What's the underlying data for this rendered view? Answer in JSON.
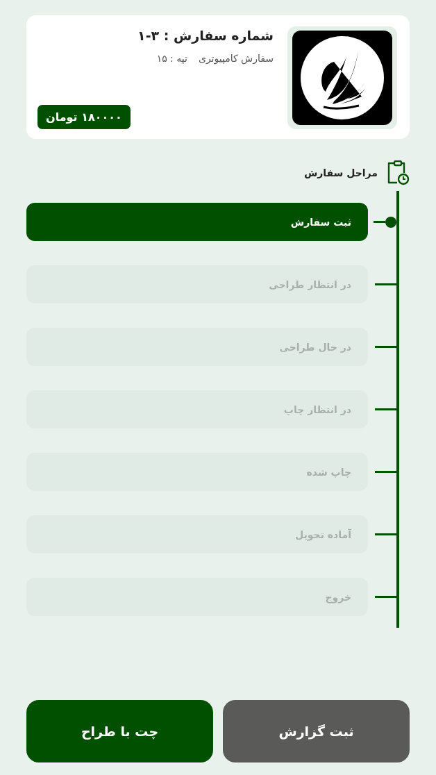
{
  "order": {
    "title": "شماره سفارش : ۳-۱",
    "category": "سفارش کامپیوتری",
    "hill": "تپه : ۱۵",
    "price": "۱۸۰۰۰۰ تومان"
  },
  "stages": {
    "title": "مراحل سفارش",
    "steps": [
      {
        "label": "ثبت سفارش",
        "selected": true
      },
      {
        "label": "در انتظار طراحی",
        "selected": false
      },
      {
        "label": "در حال طراحی",
        "selected": false
      },
      {
        "label": "در انتظار چاپ",
        "selected": false
      },
      {
        "label": "چاپ شده",
        "selected": false
      },
      {
        "label": "آماده تحویل",
        "selected": false
      },
      {
        "label": "خروج",
        "selected": false
      }
    ]
  },
  "buttons": [
    {
      "label": "ثبت گزارش",
      "kind": "secondary"
    },
    {
      "label": "چت با طراح",
      "kind": "primary"
    }
  ]
}
